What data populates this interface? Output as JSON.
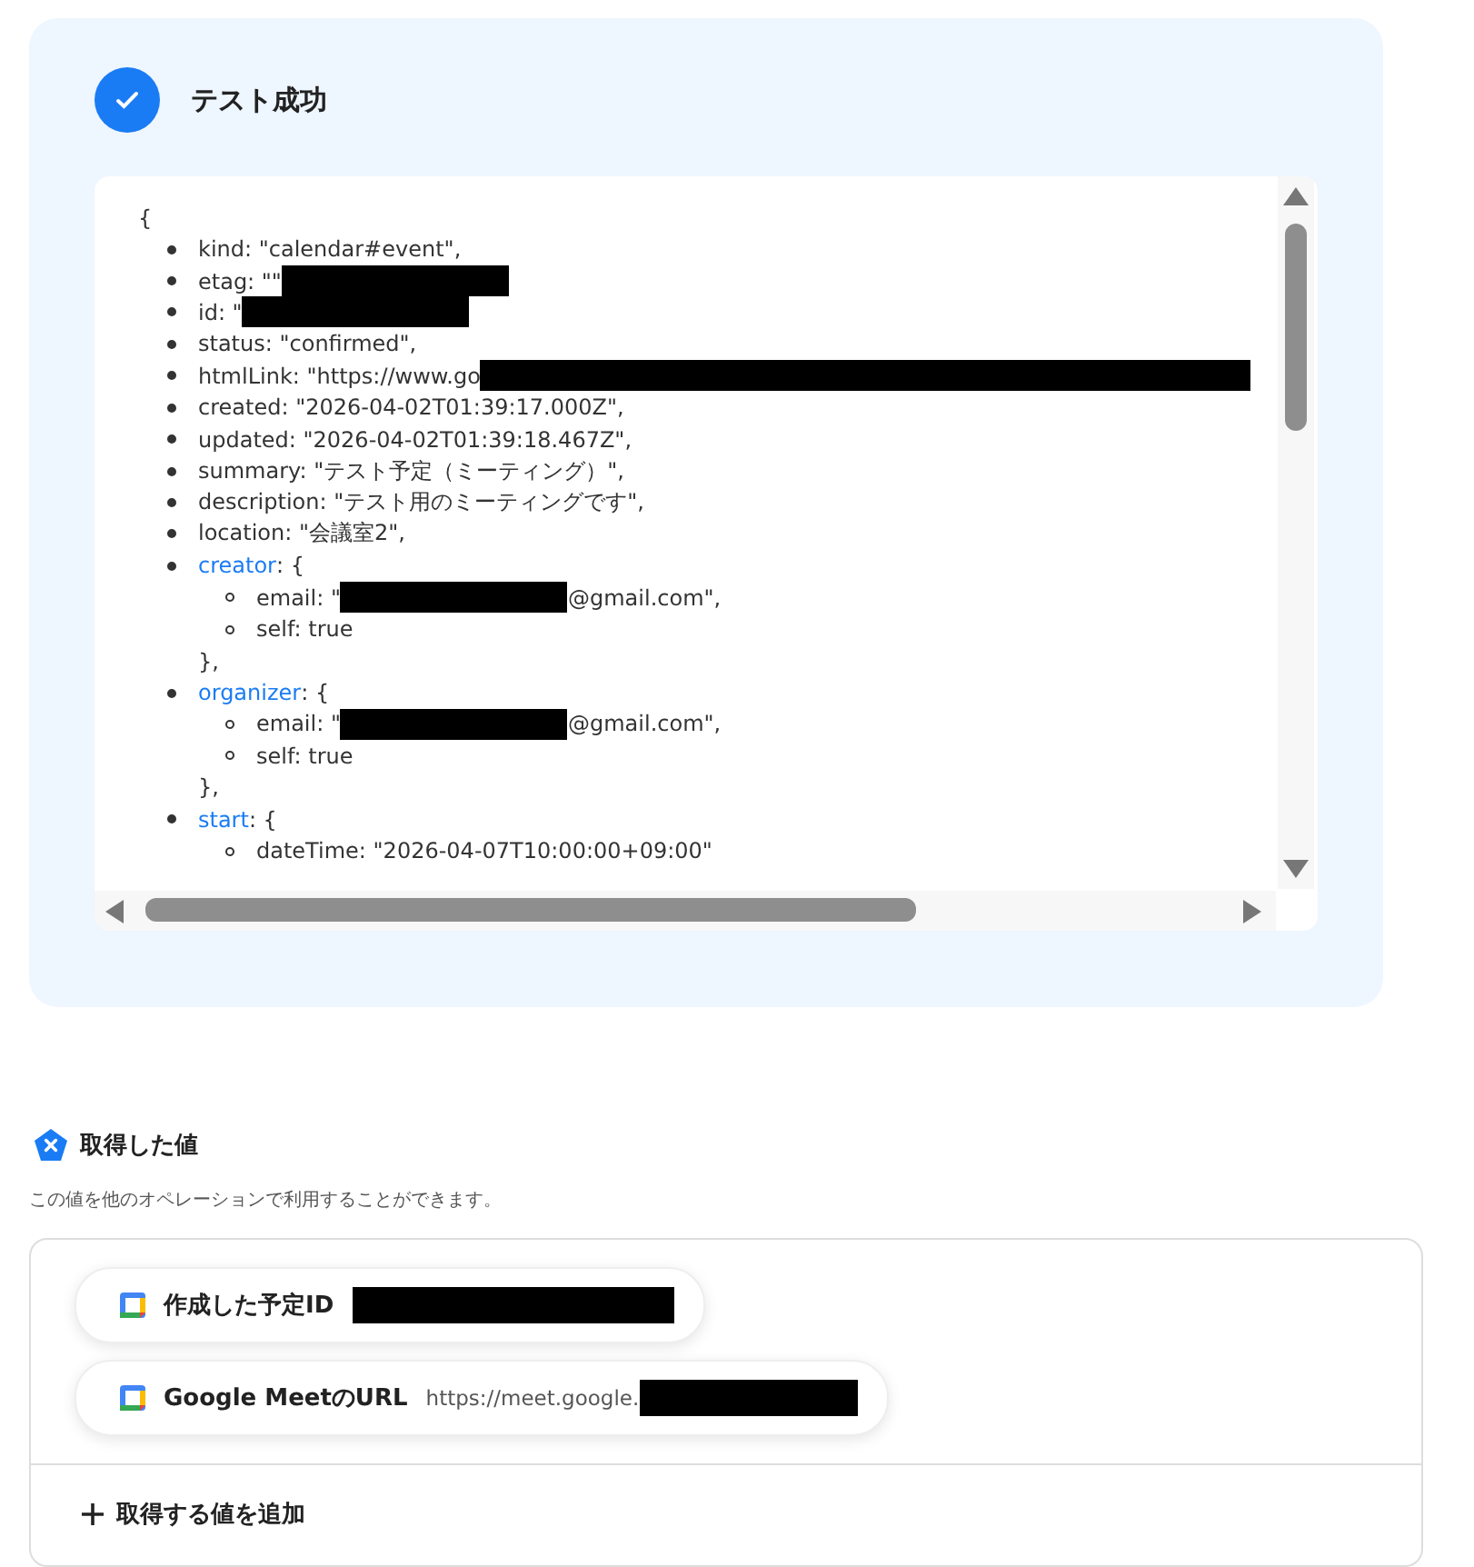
{
  "result": {
    "title": "テスト成功",
    "success": true,
    "lines": [
      {
        "kind": "brace",
        "parts": [
          {
            "kind": "text",
            "text": "{"
          }
        ]
      },
      {
        "kind": "item",
        "parts": [
          {
            "kind": "text",
            "text": "kind: \"calendar#event\","
          }
        ]
      },
      {
        "kind": "item",
        "parts": [
          {
            "kind": "text",
            "text": "etag: \"\""
          },
          {
            "kind": "redaction"
          }
        ]
      },
      {
        "kind": "item",
        "parts": [
          {
            "kind": "text",
            "text": "id: \""
          },
          {
            "kind": "redaction"
          }
        ]
      },
      {
        "kind": "item",
        "parts": [
          {
            "kind": "text",
            "text": "status: \"confirmed\","
          }
        ]
      },
      {
        "kind": "item",
        "parts": [
          {
            "kind": "text",
            "text": "htmlLink: \"https://www.go"
          },
          {
            "kind": "redaction_wide"
          }
        ]
      },
      {
        "kind": "item",
        "parts": [
          {
            "kind": "text",
            "text": "created: \"2026-04-02T01:39:17.000Z\","
          }
        ]
      },
      {
        "kind": "item",
        "parts": [
          {
            "kind": "text",
            "text": "updated: \"2026-04-02T01:39:18.467Z\","
          }
        ]
      },
      {
        "kind": "item",
        "parts": [
          {
            "kind": "text",
            "text": "summary: \"テスト予定（ミーティング）\","
          }
        ]
      },
      {
        "kind": "item",
        "parts": [
          {
            "kind": "text",
            "text": "description: \"テスト用のミーティングです\","
          }
        ]
      },
      {
        "kind": "item",
        "parts": [
          {
            "kind": "text",
            "text": "location: \"会議室2\","
          }
        ]
      },
      {
        "kind": "item",
        "parts": [
          {
            "kind": "key",
            "text": "creator"
          },
          {
            "kind": "text",
            "text": ": {"
          }
        ]
      },
      {
        "kind": "subitem",
        "parts": [
          {
            "kind": "text",
            "text": "email: \""
          },
          {
            "kind": "redaction"
          },
          {
            "kind": "text",
            "text": "@gmail.com\","
          }
        ]
      },
      {
        "kind": "subitem",
        "parts": [
          {
            "kind": "text",
            "text": "self: true"
          }
        ]
      },
      {
        "kind": "close",
        "parts": [
          {
            "kind": "text",
            "text": "},"
          }
        ]
      },
      {
        "kind": "item",
        "parts": [
          {
            "kind": "key",
            "text": "organizer"
          },
          {
            "kind": "text",
            "text": ": {"
          }
        ]
      },
      {
        "kind": "subitem",
        "parts": [
          {
            "kind": "text",
            "text": "email: \""
          },
          {
            "kind": "redaction"
          },
          {
            "kind": "text",
            "text": "@gmail.com\","
          }
        ]
      },
      {
        "kind": "subitem",
        "parts": [
          {
            "kind": "text",
            "text": "self: true"
          }
        ]
      },
      {
        "kind": "close",
        "parts": [
          {
            "kind": "text",
            "text": "},"
          }
        ]
      },
      {
        "kind": "item",
        "parts": [
          {
            "kind": "key",
            "text": "start"
          },
          {
            "kind": "text",
            "text": ": {"
          }
        ]
      },
      {
        "kind": "subitem",
        "parts": [
          {
            "kind": "text",
            "text": "dateTime: \"2026-04-07T10:00:00+09:00\""
          }
        ]
      }
    ]
  },
  "values": {
    "title": "取得した値",
    "description": "この値を他のオペレーションで利用することができます。",
    "items": [
      {
        "label": "作成した予定ID",
        "parts": [
          {
            "kind": "redaction_wide"
          }
        ]
      },
      {
        "label": "Google MeetのURL",
        "parts": [
          {
            "kind": "text",
            "text": "https://meet.google."
          },
          {
            "kind": "redaction"
          }
        ]
      }
    ],
    "add_button": "取得する値を追加"
  }
}
